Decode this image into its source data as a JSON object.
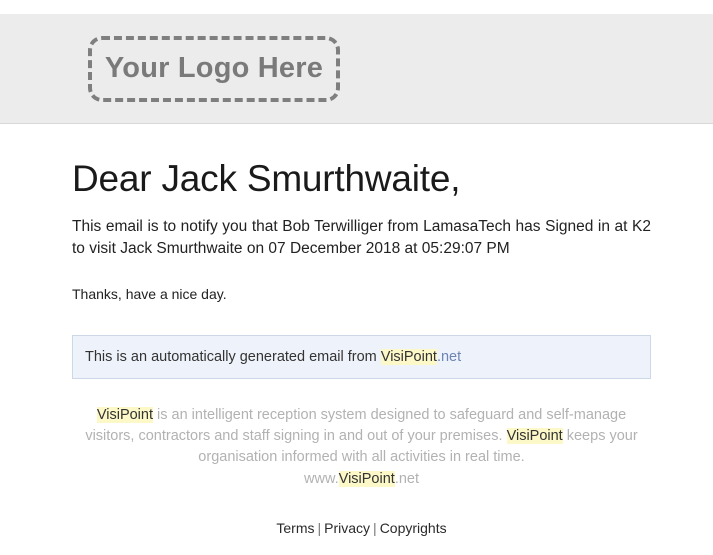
{
  "header": {
    "logo_placeholder_text": "Your Logo Here"
  },
  "email": {
    "greeting": "Dear Jack Smurthwaite,",
    "message": "This email is to notify you that Bob Terwilliger from LamasaTech has Signed in at K2 to visit Jack Smurthwaite on 07 December 2018 at 05:29:07 PM",
    "closing": "Thanks, have a nice day.",
    "details": {
      "visitor_name": "Bob Terwilliger",
      "visitor_company": "LamasaTech",
      "action": "Signed in",
      "location": "K2",
      "host_name": "Jack Smurthwaite",
      "date": "07 December 2018",
      "time": "05:29:07 PM"
    }
  },
  "notice": {
    "prefix": "This is an automatically generated email from ",
    "brand": "VisiPoint",
    "suffix": ".net"
  },
  "footer": {
    "blurb_part1": " is an intelligent reception system designed to safeguard and self-manage visitors, contractors and staff signing in and out of your premises. ",
    "brand": "VisiPoint",
    "blurb_part2": " keeps your organisation informed with all activities in real time.",
    "url_prefix": "www.",
    "url_brand": "VisiPoint",
    "url_suffix": ".net",
    "links": {
      "terms": "Terms",
      "privacy": "Privacy",
      "copyrights": "Copyrights",
      "separator": "|"
    }
  },
  "colors": {
    "header_background": "#ececec",
    "highlight": "#fcf8c8",
    "notice_background": "#eef2fa",
    "notice_border": "#ccd7e8",
    "link_blue": "#6c85b5",
    "muted_text": "#b2b2b2"
  }
}
